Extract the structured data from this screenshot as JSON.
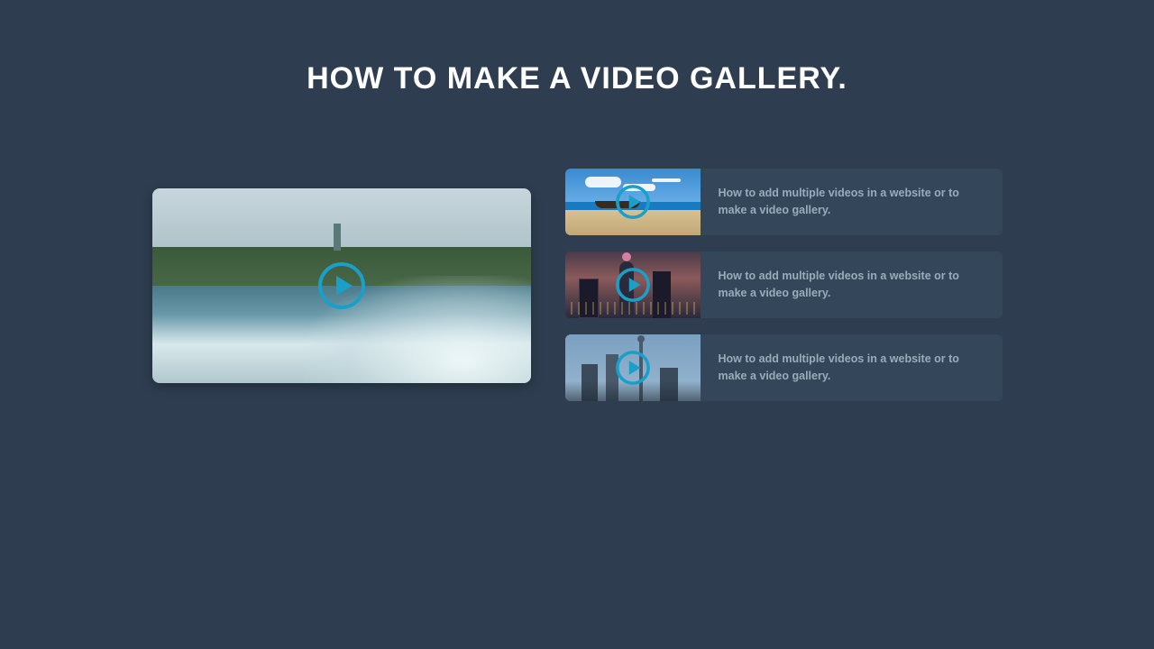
{
  "heading": "HOW TO MAKE A VIDEO GALLERY.",
  "colors": {
    "background": "#2e3e50",
    "item_bg": "#34465a",
    "play_accent": "#1aa0c8",
    "text_muted": "#9aabb9"
  },
  "main_video": {
    "scene": "waterfall",
    "alt": "Niagara Falls waterfall"
  },
  "playlist": [
    {
      "scene": "beach",
      "title": "How to add multiple videos in a website or to make a video gallery."
    },
    {
      "scene": "city",
      "title": "How to add multiple videos in a website or to make a video gallery."
    },
    {
      "scene": "cityday",
      "title": "How to add multiple videos in a website or to make a video gallery."
    }
  ]
}
